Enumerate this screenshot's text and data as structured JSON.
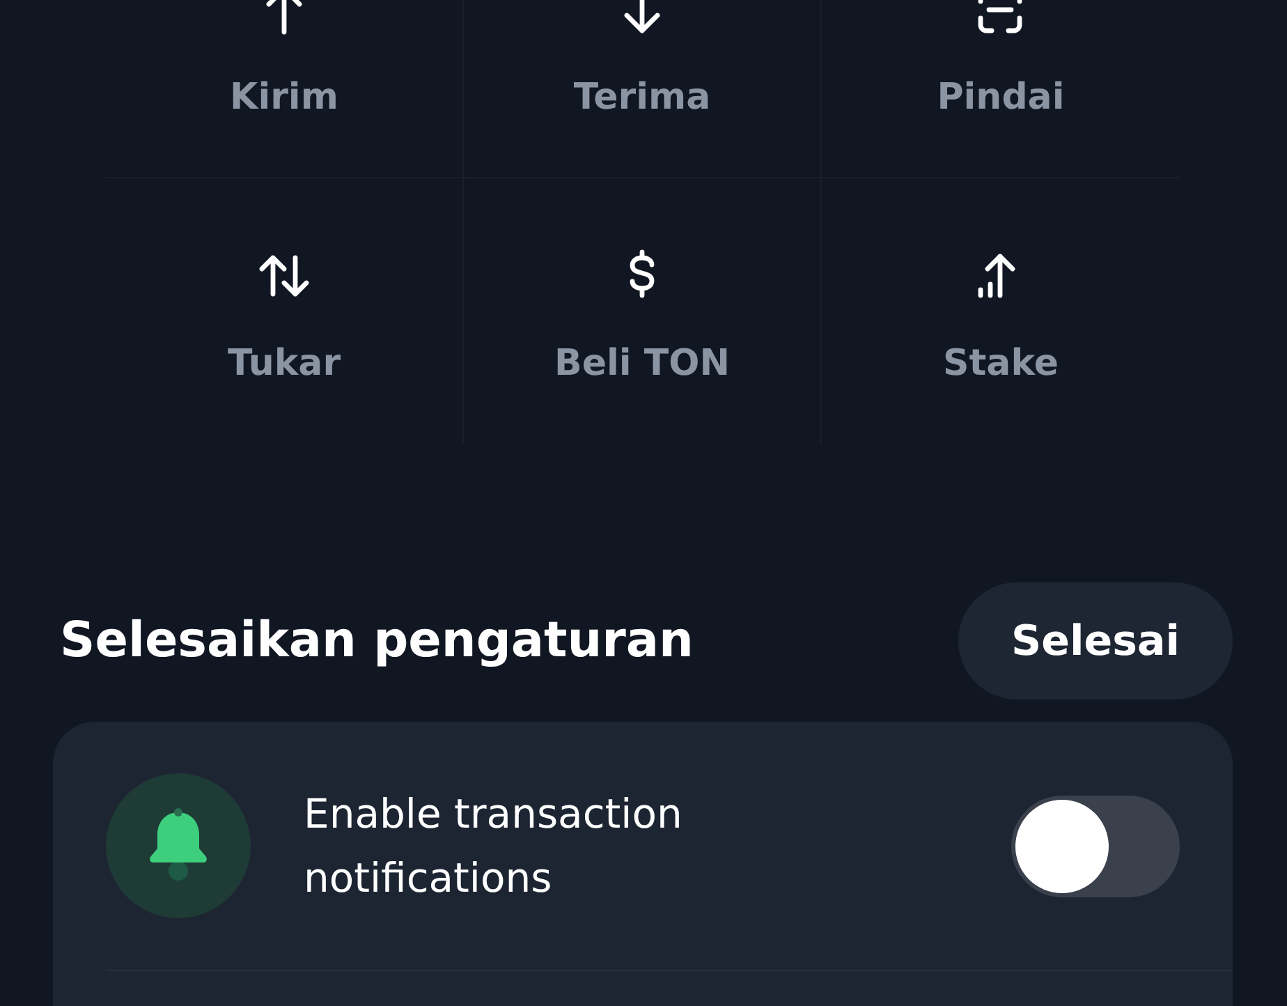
{
  "actions": [
    {
      "kind": "send",
      "label": "Kirim"
    },
    {
      "kind": "receive",
      "label": "Terima"
    },
    {
      "kind": "scan",
      "label": "Pindai"
    },
    {
      "kind": "swap",
      "label": "Tukar"
    },
    {
      "kind": "buy",
      "label": "Beli TON"
    },
    {
      "kind": "stake",
      "label": "Stake"
    }
  ],
  "setup": {
    "title": "Selesaikan pengaturan",
    "done_button": "Selesai",
    "items": [
      {
        "kind": "notifications",
        "label": "Enable transaction notifications",
        "on": false
      }
    ]
  }
}
